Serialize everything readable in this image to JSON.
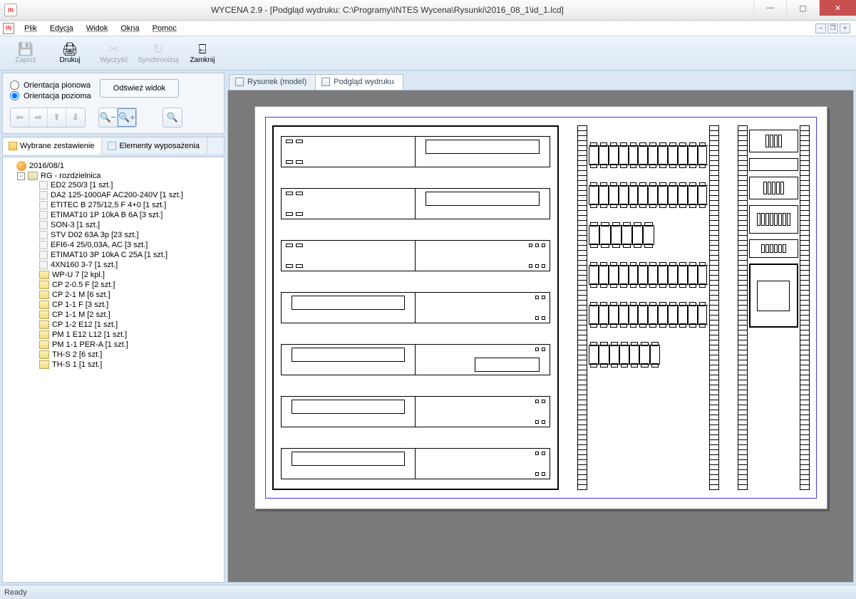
{
  "title": "WYCENA 2.9 - [Podgląd wydruku: C:\\Programy\\INTES Wycena\\Rysunki\\2016_08_1\\id_1.lcd]",
  "menu": {
    "plik": "Plik",
    "edycja": "Edycja",
    "widok": "Widok",
    "okna": "Okna",
    "pomoc": "Pomoc"
  },
  "toolbar": {
    "zapisz": "Zapisz",
    "drukuj": "Drukuj",
    "wyczysc": "Wyczyść",
    "synchronizuj": "Synchronizuj",
    "zamknij": "Zamknij"
  },
  "orientation": {
    "vertical": "Orientacja pionowa",
    "horizontal": "Orientacja pozioma",
    "refresh": "Odśwież widok"
  },
  "left_tabs": {
    "selected_list": "Wybrane zestawienie",
    "equipment": "Elementy wyposażenia"
  },
  "doc_tabs": {
    "model": "Rysunek (model)",
    "preview": "Podgląd wydruku"
  },
  "tree": {
    "root": "2016/08/1",
    "group": "RG - rozdzielnica",
    "items": [
      "ED2 250/3 [1 szt.]",
      "DA2 125-1000AF AC200-240V [1 szt.]",
      "ETITEC B 275/12,5 F 4+0 [1 szt.]",
      "ETIMAT10 1P 10kA B 6A [3 szt.]",
      "SON-3 [1 szt.]",
      "STV D02 63A 3p [23 szt.]",
      "EFI6-4 25/0,03A, AC [3 szt.]",
      "ETIMAT10 3P 10kA C 25A [1 szt.]",
      "4XN160 3-7 [1 szt.]",
      "WP-U 7 [2 kpl.]",
      "CP 2-0.5 F [2 szt.]",
      "CP 2-1 M [6 szt.]",
      "CP 1-1 F [3 szt.]",
      "CP 1-1 M [2 szt.]",
      "CP 1-2 E12 [1 szt.]",
      "PM 1 E12 L12 [1 szt.]",
      "PM 1-1 PER-A [1 szt.]",
      "TH-S 2 [6 szt.]",
      "TH-S 1 [1 szt.]"
    ]
  },
  "status": "Ready"
}
